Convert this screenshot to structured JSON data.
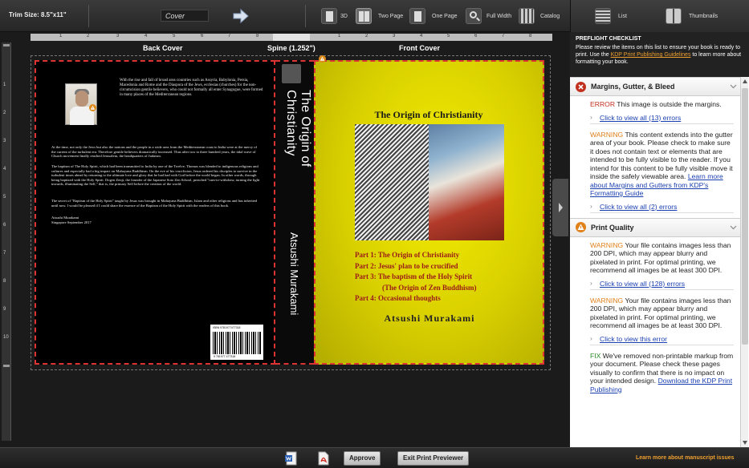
{
  "toolbar": {
    "trim_label": "Trim Size: 8.5\"x11\"",
    "page_select": "Cover",
    "view_3d": "3D",
    "view_two_page": "Two Page",
    "view_one_page": "One Page",
    "view_full_width": "Full Width",
    "view_catalog": "Catalog",
    "view_list": "List",
    "view_thumbnails": "Thumbnails"
  },
  "ruler": {
    "back_ticks": [
      "1",
      "2",
      "3",
      "4",
      "5",
      "6",
      "7",
      "8"
    ],
    "front_ticks": [
      "1",
      "2",
      "3",
      "4",
      "5",
      "6",
      "7",
      "8"
    ],
    "vertical_ticks": [
      "1",
      "2",
      "3",
      "4",
      "5",
      "6",
      "7",
      "8",
      "9",
      "10"
    ]
  },
  "sections": {
    "back_cover": "Back Cover",
    "spine": "Spine (1.252\")",
    "front_cover": "Front Cover"
  },
  "book": {
    "back_para1": "With the rise and fall of broad area countries such as Assyria, Babylonia, Persia, Macedonia and Rome and the Diaspora of the Jews, ecclesias (churches) for the non-circumcision gentile believers, who could not formally all enter Synagogue, were formed in many places of the Mediterranean regions.",
    "back_para2": "At the time, not only the Jews but also the nations and the people in a wide area from the Mediterranean coast to India were at the mercy of the current of the turbulent era. Therefore gentile believers dramatically increased. Thus after two to three hundred years, the tidal wave of Church movement finally reached Jerusalem, the headquarters of Judaism.",
    "back_para3": "The baptism of The Holy Spirit, which had been transmitted to India by one of the Twelve, Thomas was blended to indigenous religions and cultures and especially had a big impact on Mahayana Buddhism. On the eve of his crucifixion, Jesus ordered his disciples to survive in the turbulent times ahead by returning to the ultimate love and glory that he had had with God before the world began. In other words, through being baptized with the Holy Spirit. Dogen Zenji, the founder of the Japanese Soto Zen School, preached \"turn-to-withdraw, turning the light inwards, illuminating the Self,\" that is, the primary Self before the creation of the world.",
    "back_para4": "The secret of \"Baptism of the Holy Spirit\" taught by Jesus was brought in Mahayana Buddhism, Islam and other religions and has inherited until now. I would be pleased if I could share the essence of the Baptism of the Holy Spirit with the readers of this book.",
    "back_sign_name": "Atsushi Murakami",
    "back_sign_place": "Singapore September 2017",
    "isbn_top": "ISBN 9781977477318",
    "isbn_num": "9 781977 477318",
    "spine_title": "The Origin of Christianity",
    "spine_author": "Atsushi Murakami",
    "cover_title": "The Origin of Christianity",
    "cover_parts": [
      "Part 1: The Origin of Christianity",
      "Part 2: Jesus' plan to be crucified",
      "Part 3: The baptism of the Holy Spirit",
      "(The Origin of Zen Buddhism)",
      "Part 4: Occasional thoughts"
    ],
    "cover_author": "Atsushi Murakami"
  },
  "panel": {
    "title": "PREFLIGHT CHECKLIST",
    "intro_a": "Please review the items on this list to ensure your book is ready to print. Use the ",
    "intro_link": "KDP Print Publishing Guidelines",
    "intro_b": " to learn more about formatting your book.",
    "sec1_title": "Margins, Gutter, & Bleed",
    "sec1_error_label": "ERROR",
    "sec1_error_text": " This image is outside the margins.",
    "sec1_error_link": "Click to view all (13) errors",
    "sec1_warn_label": "WARNING",
    "sec1_warn_text": " This content extends into the gutter area of your book. Please check to make sure it does not contain text or elements that are intended to be fully visible to the reader. If you intend for this content to be fully visible move it inside the safely viewable area.",
    "sec1_warn_link_inline": "Learn more about Margins and Gutters from KDP's Formatting Guide",
    "sec1_warn_link": "Click to view all (2) errors",
    "sec2_title": "Print Quality",
    "sec2_warn1_label": "WARNING",
    "sec2_warn1_text": " Your file contains images less than 200 DPI, which may appear blurry and pixelated in print. For optimal printing, we recommend all images be at least 300 DPI.",
    "sec2_warn1_link": "Click to view all (128) errors",
    "sec2_warn2_label": "WARNING",
    "sec2_warn2_text": " Your file contains images less than 200 DPI, which may appear blurry and pixelated in print. For optimal printing, we recommend all images be at least 300 DPI.",
    "sec2_warn2_link": "Click to view this error",
    "sec2_fix_label": "FIX",
    "sec2_fix_text": " We've removed non-printable markup from your document. Please check these pages visually to confirm that there is no impact on your intended design.",
    "sec2_fix_link": "Download the KDP Print Publishing"
  },
  "bottom": {
    "approve": "Approve",
    "exit": "Exit Print Previewer",
    "learn_more": "Learn more about manuscript issues"
  },
  "colors": {
    "error": "#c0301c",
    "warning": "#e0811a",
    "fix": "#2a8a2a",
    "link": "#1a3fb0",
    "accent": "#f0a030",
    "cover": "#e6de00"
  }
}
